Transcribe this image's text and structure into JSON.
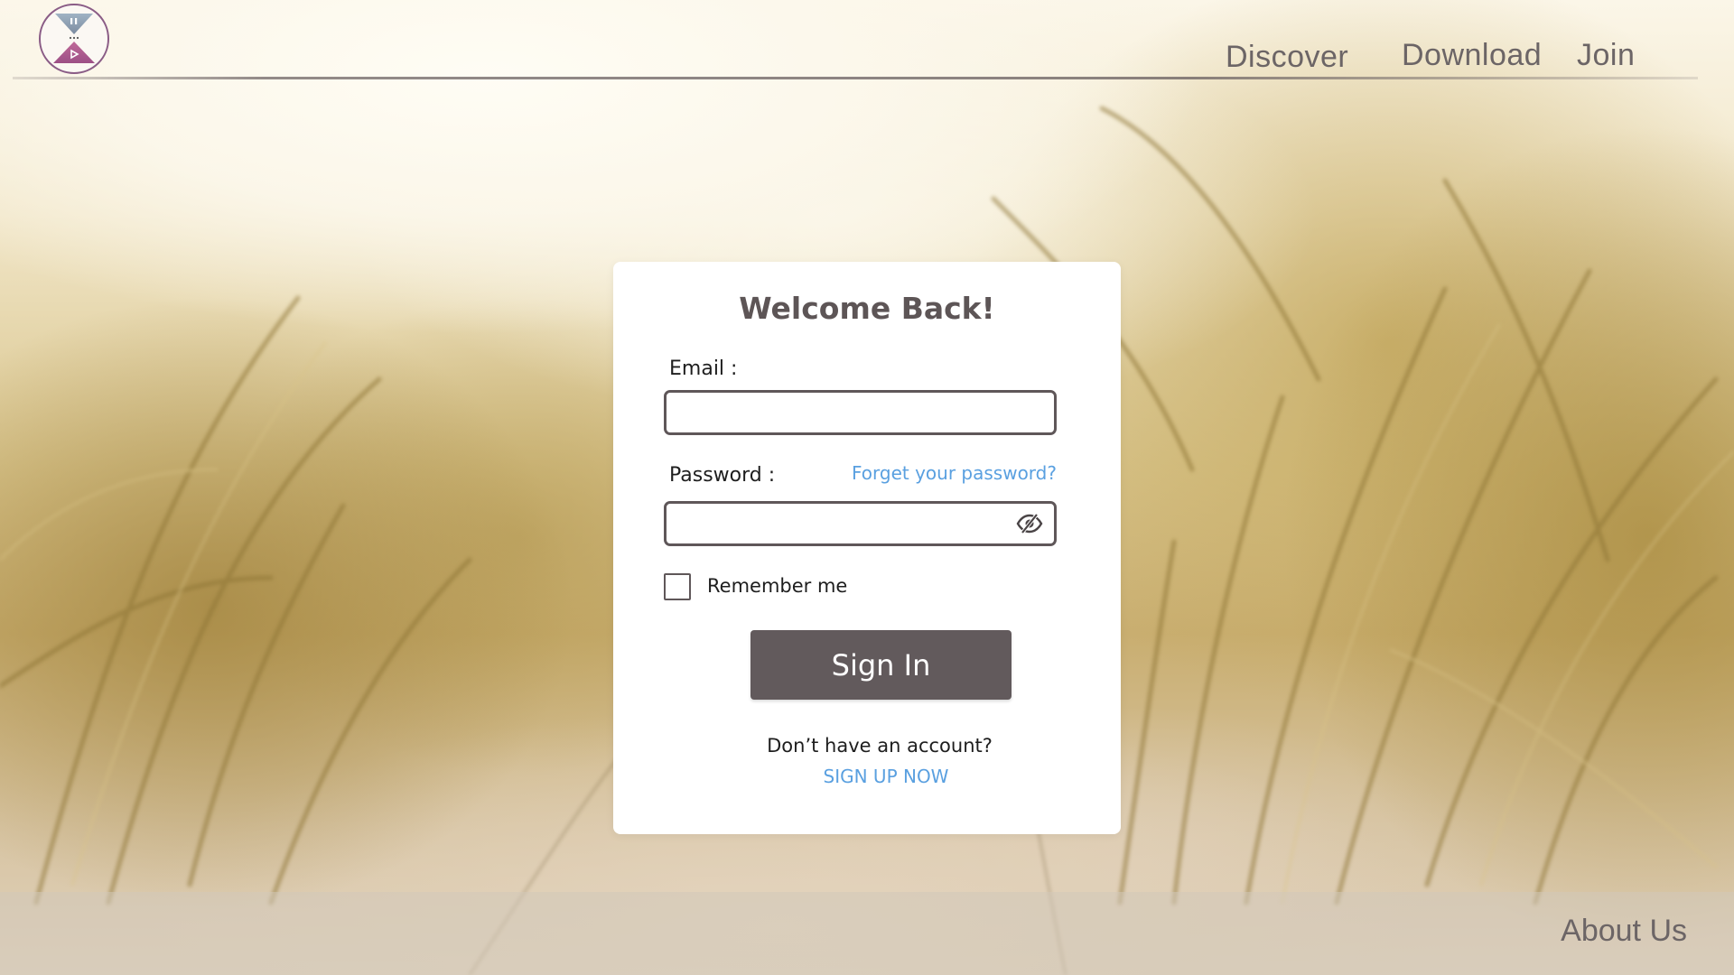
{
  "header": {
    "logo_icon": "hourglass-play-pause-logo",
    "nav": [
      {
        "label": "Discover"
      },
      {
        "label": "Download"
      },
      {
        "label": "Join"
      }
    ]
  },
  "login": {
    "title": "Welcome Back!",
    "email_label": "Email :",
    "email_value": "",
    "password_label": "Password :",
    "password_value": "",
    "forgot_label": "Forget your password?",
    "password_toggle_icon": "eye-slash-icon",
    "remember_label": "Remember me",
    "remember_checked": false,
    "signin_label": "Sign In",
    "no_account_text": "Don’t have an account?",
    "signup_label": "SIGN UP NOW"
  },
  "footer": {
    "about_label": "About Us"
  },
  "colors": {
    "button": "#625a5c",
    "link": "#5aa0e0",
    "nav_text": "#6c6566",
    "logo_accent": "#b05a8e"
  }
}
